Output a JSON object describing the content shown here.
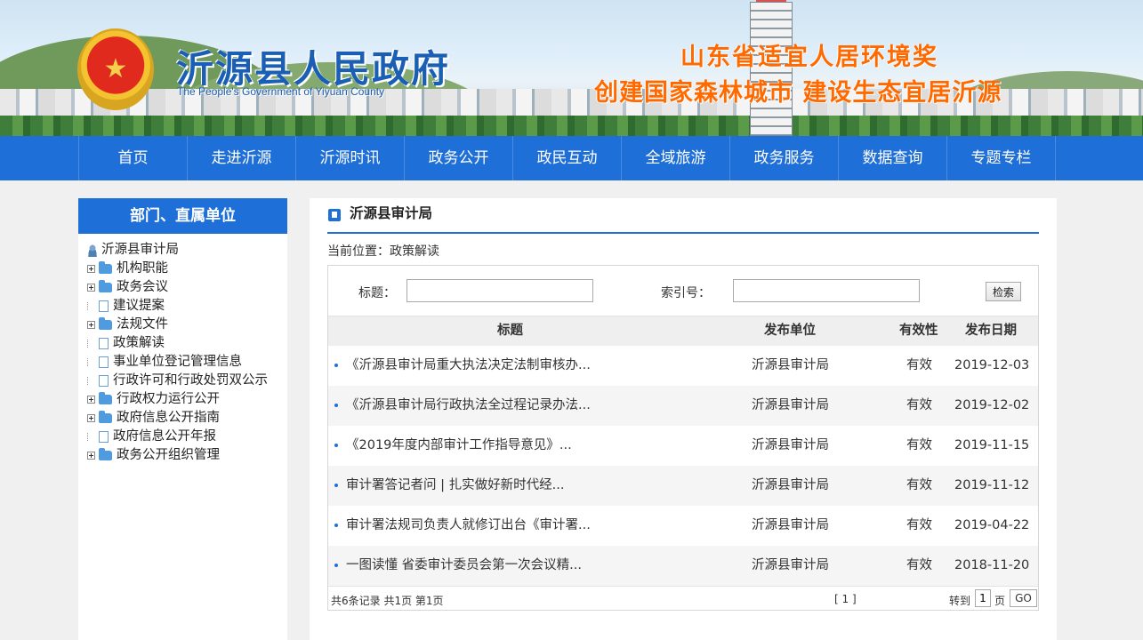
{
  "header": {
    "site_title": "沂源县人民政府",
    "site_subtitle": "The People's Government of Yiyuan County",
    "slogan_line1": "山东省适宜人居环境奖",
    "slogan_line2": "创建国家森林城市  建设生态宜居沂源"
  },
  "nav": {
    "items": [
      {
        "label": "首页"
      },
      {
        "label": "走进沂源"
      },
      {
        "label": "沂源时讯"
      },
      {
        "label": "政务公开"
      },
      {
        "label": "政民互动"
      },
      {
        "label": "全域旅游"
      },
      {
        "label": "政务服务"
      },
      {
        "label": "数据查询"
      },
      {
        "label": "专题专栏"
      }
    ]
  },
  "sidebar": {
    "heading": "部门、直属单位",
    "root": "沂源县审计局",
    "items": [
      {
        "label": "机构职能",
        "type": "folder"
      },
      {
        "label": "政务会议",
        "type": "folder"
      },
      {
        "label": "建议提案",
        "type": "page"
      },
      {
        "label": "法规文件",
        "type": "folder"
      },
      {
        "label": "政策解读",
        "type": "page"
      },
      {
        "label": "事业单位登记管理信息",
        "type": "page"
      },
      {
        "label": "行政许可和行政处罚双公示",
        "type": "page"
      },
      {
        "label": "行政权力运行公开",
        "type": "folder"
      },
      {
        "label": "政府信息公开指南",
        "type": "folder"
      },
      {
        "label": "政府信息公开年报",
        "type": "page"
      },
      {
        "label": "政务公开组织管理",
        "type": "folder"
      }
    ]
  },
  "main": {
    "title": "沂源县审计局",
    "location": "当前位置：政策解读",
    "search": {
      "title_label": "标题：",
      "title_value": "",
      "index_label": "索引号：",
      "index_value": "",
      "button_label": "检索"
    },
    "table": {
      "columns": [
        "标题",
        "发布单位",
        "有效性",
        "发布日期"
      ],
      "rows": [
        {
          "title": "《沂源县审计局重大执法决定法制审核办...",
          "unit": "沂源县审计局",
          "validity": "有效",
          "date": "2019-12-03"
        },
        {
          "title": "《沂源县审计局行政执法全过程记录办法...",
          "unit": "沂源县审计局",
          "validity": "有效",
          "date": "2019-12-02"
        },
        {
          "title": "《2019年度内部审计工作指导意见》...",
          "unit": "沂源县审计局",
          "validity": "有效",
          "date": "2019-11-15"
        },
        {
          "title": "审计署答记者问 | 扎实做好新时代经...",
          "unit": "沂源县审计局",
          "validity": "有效",
          "date": "2019-11-12"
        },
        {
          "title": "审计署法规司负责人就修订出台《审计署...",
          "unit": "沂源县审计局",
          "validity": "有效",
          "date": "2019-04-22"
        },
        {
          "title": "一图读懂 省委审计委员会第一次会议精...",
          "unit": "沂源县审计局",
          "validity": "有效",
          "date": "2018-11-20"
        }
      ]
    },
    "pager": {
      "summary": "共6条记录  共1页  第1页",
      "pages": "[ 1 ]",
      "goto_label": "转到",
      "page_value": "1",
      "page_suffix": "页",
      "go_label": "GO"
    }
  },
  "colors": {
    "brand_blue": "#1f6fd8",
    "slogan_orange": "#ff6a00"
  }
}
